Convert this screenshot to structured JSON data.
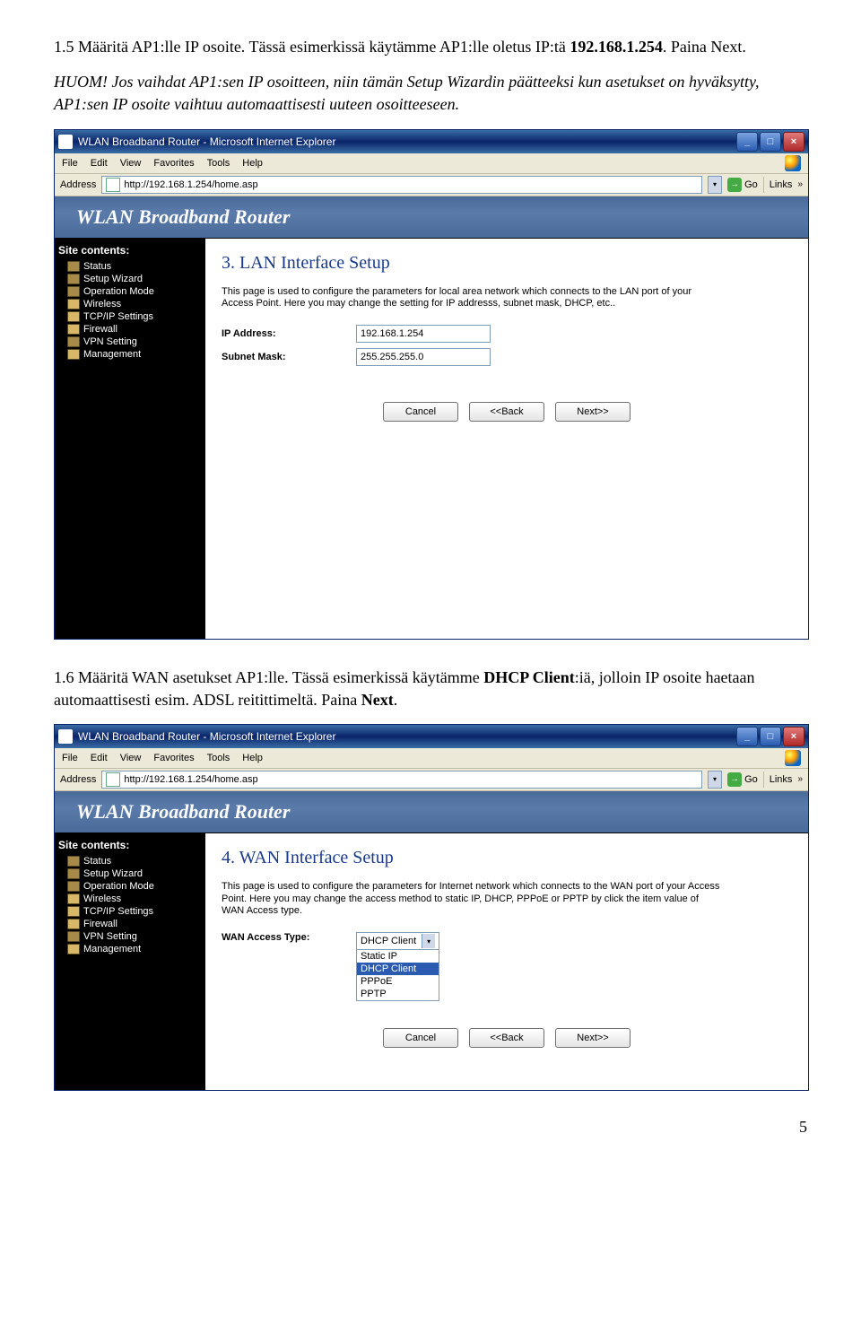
{
  "doc": {
    "p1_a": "1.5 Määritä AP1:lle IP osoite. Tässä esimerkissä käytämme AP1:lle oletus IP:tä ",
    "p1_ip": "192.168.1.254",
    "p1_b": ". Paina Next.",
    "p2_a": "HUOM! Jos vaihdat AP1:sen IP osoitteen, niin tämän Setup Wizardin päätteeksi kun asetukset on hyväksytty, AP1:sen IP osoite vaihtuu automaattisesti uuteen osoitteeseen.",
    "p3_a": "1.6 Määritä WAN asetukset AP1:lle. Tässä esimerkissä käytämme ",
    "p3_b": "DHCP Client",
    "p3_c": ":iä, jolloin IP osoite haetaan automaattisesti esim. ADSL reitittimeltä. Paina ",
    "p3_d": "Next",
    "p3_e": ".",
    "page_number": "5"
  },
  "browser": {
    "title": "WLAN Broadband Router - Microsoft Internet Explorer",
    "menu": [
      "File",
      "Edit",
      "View",
      "Favorites",
      "Tools",
      "Help"
    ],
    "address_label": "Address",
    "url": "http://192.168.1.254/home.asp",
    "go": "Go",
    "links": "Links",
    "banner": "WLAN Broadband Router"
  },
  "sidebar": {
    "title": "Site contents:",
    "items": [
      {
        "label": "Status",
        "open": false
      },
      {
        "label": "Setup Wizard",
        "open": false
      },
      {
        "label": "Operation Mode",
        "open": false
      },
      {
        "label": "Wireless",
        "open": true
      },
      {
        "label": "TCP/IP Settings",
        "open": true
      },
      {
        "label": "Firewall",
        "open": true
      },
      {
        "label": "VPN Setting",
        "open": false
      },
      {
        "label": "Management",
        "open": true
      }
    ]
  },
  "screen1": {
    "heading": "3. LAN Interface Setup",
    "descr": "This page is used to configure the parameters for local area network which connects to the LAN port of your Access Point. Here you may change the setting for IP addresss, subnet mask, DHCP, etc..",
    "ip_label": "IP Address:",
    "ip_value": "192.168.1.254",
    "mask_label": "Subnet Mask:",
    "mask_value": "255.255.255.0"
  },
  "screen2": {
    "heading": "4. WAN Interface Setup",
    "descr": "This page is used to configure the parameters for Internet network which connects to the WAN port of your Access Point. Here you may change the access method to static IP, DHCP, PPPoE or PPTP by click the item value of WAN Access type.",
    "wat_label": "WAN Access Type:",
    "wat_selected": "DHCP Client",
    "wat_options": [
      "Static IP",
      "DHCP Client",
      "PPPoE",
      "PPTP"
    ]
  },
  "buttons": {
    "cancel": "Cancel",
    "back": "<<Back",
    "next": "Next>>"
  }
}
